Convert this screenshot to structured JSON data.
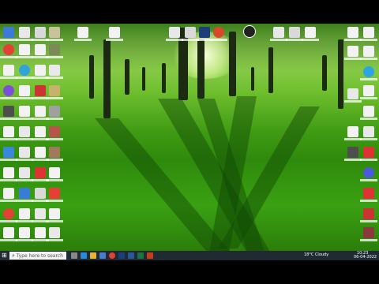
{
  "taskbar": {
    "start_icon": "windows-logo-icon",
    "search_placeholder": "Type here to search",
    "apps": [
      "task-view-icon",
      "edge-icon",
      "file-explorer-icon",
      "store-icon",
      "mail-icon",
      "chrome-icon",
      "photoshop-icon",
      "word-icon",
      "excel-icon",
      "powerpoint-icon"
    ],
    "weather": "18°C Cloudy",
    "time": "10:23",
    "date": "06-04-2022"
  },
  "desktop": {
    "wallpaper": "green-park-forest",
    "accent_colors": {
      "grass": "#3aa112",
      "trunk": "#1d2a12",
      "taskbar": "#1f2a33"
    }
  }
}
